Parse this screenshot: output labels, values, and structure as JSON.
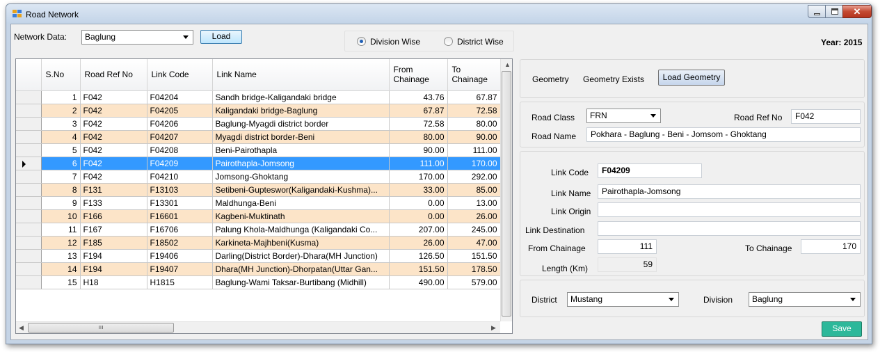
{
  "window": {
    "title": "Road Network"
  },
  "toolbar": {
    "network_label": "Network Data:",
    "network_value": "Baglung",
    "load_label": "Load",
    "radio_division": "Division Wise",
    "radio_district": "District Wise",
    "year_label": "Year: 2015"
  },
  "grid": {
    "columns": [
      "S.No",
      "Road Ref No",
      "Link Code",
      "Link Name",
      "From Chainage",
      "To Chainage"
    ],
    "rows": [
      [
        "1",
        "F042",
        "F04204",
        "Sandh bridge-Kaligandaki bridge",
        "43.76",
        "67.87"
      ],
      [
        "2",
        "F042",
        "F04205",
        "Kaligandaki bridge-Baglung",
        "67.87",
        "72.58"
      ],
      [
        "3",
        "F042",
        "F04206",
        "Baglung-Myagdi district border",
        "72.58",
        "80.00"
      ],
      [
        "4",
        "F042",
        "F04207",
        "Myagdi district border-Beni",
        "80.00",
        "90.00"
      ],
      [
        "5",
        "F042",
        "F04208",
        "Beni-Pairothapla",
        "90.00",
        "111.00"
      ],
      [
        "6",
        "F042",
        "F04209",
        "Pairothapla-Jomsong",
        "111.00",
        "170.00"
      ],
      [
        "7",
        "F042",
        "F04210",
        "Jomsong-Ghoktang",
        "170.00",
        "292.00"
      ],
      [
        "8",
        "F131",
        "F13103",
        "Setibeni-Gupteswor(Kaligandaki-Kushma)...",
        "33.00",
        "85.00"
      ],
      [
        "9",
        "F133",
        "F13301",
        "Maldhunga-Beni",
        "0.00",
        "13.00"
      ],
      [
        "10",
        "F166",
        "F16601",
        "Kagbeni-Muktinath",
        "0.00",
        "26.00"
      ],
      [
        "11",
        "F167",
        "F16706",
        "Palung Khola-Maldhunga (Kaligandaki Co...",
        "207.00",
        "245.00"
      ],
      [
        "12",
        "F185",
        "F18502",
        "Karkineta-Majhbeni(Kusma)",
        "26.00",
        "47.00"
      ],
      [
        "13",
        "F194",
        "F19406",
        "Darling(District Border)-Dhara(MH Junction)",
        "126.50",
        "151.50"
      ],
      [
        "14",
        "F194",
        "F19407",
        "Dhara(MH Junction)-Dhorpatan(Uttar Gan...",
        "151.50",
        "178.50"
      ],
      [
        "15",
        "H18",
        "H1815",
        "Baglung-Wami Taksar-Burtibang (Midhill)",
        "490.00",
        "579.00"
      ]
    ],
    "selected_row": 6
  },
  "geometry": {
    "label": "Geometry",
    "status": "Geometry Exists",
    "load_label": "Load Geometry"
  },
  "road": {
    "class_label": "Road Class",
    "class_value": "FRN",
    "ref_label": "Road Ref No",
    "ref_value": "F042",
    "name_label": "Road Name",
    "name_value": "Pokhara - Baglung - Beni - Jomsom - Ghoktang"
  },
  "link": {
    "code_label": "Link Code",
    "code_value": "F04209",
    "name_label": "Link Name",
    "name_value": "Pairothapla-Jomsong",
    "origin_label": "Link Origin",
    "origin_value": "",
    "destination_label": "Link  Destination",
    "destination_value": "",
    "from_label": "From Chainage",
    "from_value": "111",
    "to_label": "To Chainage",
    "to_value": "170",
    "length_label": "Length (Km)",
    "length_value": "59"
  },
  "location": {
    "district_label": "District",
    "district_value": "Mustang",
    "division_label": "Division",
    "division_value": "Baglung"
  },
  "save_label": "Save",
  "colors": {
    "selected_row": "#3399ff",
    "alt_row": "#fce4c8",
    "save_button": "#2db89a"
  }
}
